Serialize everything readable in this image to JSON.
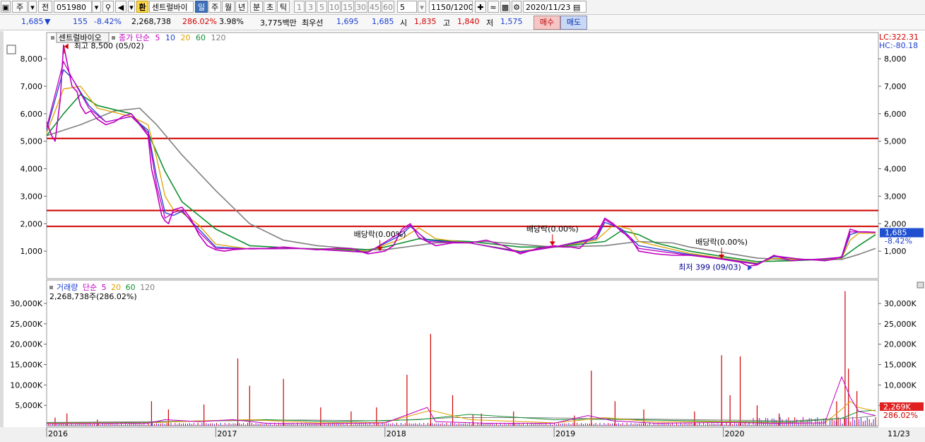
{
  "toolbar": {
    "period_select": "주",
    "market_select": "전",
    "code": "051980",
    "hwan_label": "환",
    "stock_name": "센트럴바이",
    "tabs": [
      "일",
      "주",
      "월",
      "년",
      "분",
      "초",
      "틱"
    ],
    "active_tab": "일",
    "intervals": [
      "1",
      "3",
      "5",
      "10",
      "15",
      "30",
      "45",
      "60"
    ],
    "interval_input": "5",
    "count": "1150",
    "count_total": "/1200",
    "date": "2020/11/23"
  },
  "info": {
    "price": "1,685",
    "change_arrow": "▼",
    "change": "155",
    "change_pct": "-8.42%",
    "volume": "2,268,738",
    "volume_pct": "286.02%",
    "turnover": "3.98%",
    "amount": "3,775백만",
    "bid_label": "최우선",
    "bid1": "1,695",
    "bid2": "1,685",
    "open_label": "시",
    "open": "1,835",
    "high_label": "고",
    "high": "1,840",
    "low_label": "저",
    "low": "1,575",
    "buy_label": "매수",
    "sell_label": "매도"
  },
  "colors": {
    "ma5": "#c000c0",
    "ma10": "#2040d0",
    "ma20": "#e0a000",
    "ma60": "#109030",
    "ma120": "#808080",
    "hline": "#d00000",
    "price_badge": "#2050d0",
    "volume_badge": "#e02020"
  },
  "chart_data": [
    {
      "type": "line",
      "legend": {
        "name": "센트럴바이오",
        "series_label": "종가",
        "ma_type": "단순",
        "periods": [
          "5",
          "10",
          "20",
          "60",
          "120"
        ]
      },
      "ylim": [
        0,
        8800
      ],
      "yticks": [
        "1,000",
        "2,000",
        "3,000",
        "4,000",
        "5,000",
        "6,000",
        "7,000",
        "8,000"
      ],
      "ytick_values": [
        1000,
        2000,
        3000,
        4000,
        5000,
        6000,
        7000,
        8000
      ],
      "x_labels": [
        "2016",
        "2017",
        "2018",
        "2019",
        "2020",
        "11/23"
      ],
      "x_label_dates": [
        2016.0,
        2017.0,
        2018.0,
        2019.0,
        2020.0,
        2020.9
      ],
      "x_range": [
        2016.0,
        2020.9
      ],
      "top_right": {
        "lc": "LC:322.31",
        "hc": "HC:-80.18"
      },
      "current_price": "1,685",
      "current_change": "-8.42%",
      "horizontal_lines": [
        5100,
        2480,
        1900
      ],
      "series": [
        {
          "name": "종가",
          "color": "#c000c0",
          "x": [
            2016.0,
            2016.03,
            2016.05,
            2016.08,
            2016.1,
            2016.13,
            2016.15,
            2016.18,
            2016.2,
            2016.23,
            2016.26,
            2016.3,
            2016.35,
            2016.4,
            2016.45,
            2016.5,
            2016.55,
            2016.6,
            2016.62,
            2016.65,
            2016.68,
            2016.7,
            2016.72,
            2016.75,
            2016.8,
            2016.85,
            2016.9,
            2016.95,
            2017.0,
            2017.05,
            2017.1,
            2017.2,
            2017.3,
            2017.4,
            2017.5,
            2017.6,
            2017.7,
            2017.8,
            2017.9,
            2017.95,
            2018.0,
            2018.05,
            2018.1,
            2018.15,
            2018.2,
            2018.25,
            2018.3,
            2018.4,
            2018.5,
            2018.6,
            2018.7,
            2018.8,
            2018.9,
            2019.0,
            2019.05,
            2019.1,
            2019.15,
            2019.2,
            2019.25,
            2019.3,
            2019.35,
            2019.4,
            2019.45,
            2019.5,
            2019.6,
            2019.7,
            2019.8,
            2019.9,
            2020.0,
            2020.1,
            2020.15,
            2020.2,
            2020.3,
            2020.4,
            2020.5,
            2020.6,
            2020.65,
            2020.7,
            2020.75,
            2020.8,
            2020.85,
            2020.9
          ],
          "y": [
            5700,
            5200,
            5000,
            6500,
            8500,
            7600,
            7000,
            6800,
            6300,
            6000,
            6100,
            5800,
            5600,
            5700,
            5900,
            6000,
            5600,
            5200,
            4000,
            3200,
            2300,
            2100,
            2000,
            2500,
            2600,
            2200,
            1600,
            1200,
            1050,
            1000,
            1050,
            1100,
            1100,
            1150,
            1100,
            1050,
            1100,
            1100,
            900,
            950,
            1000,
            1200,
            1800,
            2000,
            1500,
            1350,
            1200,
            1300,
            1300,
            1400,
            1200,
            900,
            1100,
            1200,
            1150,
            1150,
            1100,
            1400,
            1600,
            2200,
            2000,
            1700,
            1500,
            1000,
            900,
            850,
            850,
            800,
            700,
            600,
            450,
            500,
            850,
            650,
            700,
            650,
            700,
            800,
            1800,
            1700,
            1700,
            1685
          ]
        },
        {
          "name": "5",
          "color": "#c000c0",
          "x": [
            2016.0,
            2016.1,
            2016.15,
            2016.25,
            2016.35,
            2016.5,
            2016.6,
            2016.65,
            2016.7,
            2016.75,
            2016.8,
            2016.9,
            2017.0,
            2017.2,
            2017.5,
            2017.9,
            2018.1,
            2018.15,
            2018.25,
            2018.5,
            2018.8,
            2019.0,
            2019.25,
            2019.3,
            2019.4,
            2019.5,
            2019.8,
            2020.0,
            2020.2,
            2020.3,
            2020.5,
            2020.7,
            2020.75,
            2020.8,
            2020.9
          ],
          "y": [
            5500,
            7900,
            7300,
            6200,
            5700,
            5900,
            5300,
            3400,
            2200,
            2400,
            2500,
            1700,
            1100,
            1080,
            1100,
            950,
            1700,
            1950,
            1350,
            1300,
            950,
            1150,
            1500,
            2150,
            1750,
            1100,
            850,
            700,
            520,
            830,
            680,
            780,
            1700,
            1700,
            1690
          ]
        },
        {
          "name": "10",
          "color": "#2040d0",
          "x": [
            2016.0,
            2016.1,
            2016.15,
            2016.25,
            2016.35,
            2016.5,
            2016.6,
            2016.65,
            2016.7,
            2016.75,
            2016.8,
            2016.9,
            2017.0,
            2017.2,
            2017.5,
            2017.9,
            2018.1,
            2018.15,
            2018.25,
            2018.5,
            2018.8,
            2019.0,
            2019.25,
            2019.3,
            2019.4,
            2019.5,
            2019.8,
            2020.0,
            2020.2,
            2020.3,
            2020.5,
            2020.7,
            2020.75,
            2020.8,
            2020.9
          ],
          "y": [
            5400,
            7600,
            7300,
            6300,
            5700,
            5900,
            5400,
            3700,
            2400,
            2300,
            2450,
            1800,
            1150,
            1080,
            1100,
            970,
            1600,
            1900,
            1400,
            1300,
            980,
            1150,
            1450,
            2050,
            1800,
            1200,
            880,
            720,
            540,
            800,
            690,
            760,
            1600,
            1700,
            1680
          ]
        },
        {
          "name": "20",
          "color": "#e0a000",
          "x": [
            2016.0,
            2016.1,
            2016.2,
            2016.3,
            2016.5,
            2016.6,
            2016.65,
            2016.7,
            2016.75,
            2016.8,
            2016.9,
            2017.0,
            2017.2,
            2017.5,
            2017.9,
            2018.1,
            2018.2,
            2018.3,
            2018.5,
            2018.8,
            2019.0,
            2019.25,
            2019.35,
            2019.45,
            2019.5,
            2019.8,
            2020.0,
            2020.2,
            2020.3,
            2020.5,
            2020.7,
            2020.75,
            2020.8,
            2020.9
          ],
          "y": [
            5300,
            6900,
            7000,
            6200,
            5900,
            5600,
            4400,
            3000,
            2500,
            2400,
            1950,
            1250,
            1080,
            1100,
            1000,
            1450,
            1850,
            1450,
            1300,
            1000,
            1150,
            1400,
            1950,
            1800,
            1350,
            920,
            740,
            560,
            740,
            690,
            740,
            1400,
            1650,
            1650
          ]
        },
        {
          "name": "60",
          "color": "#109030",
          "x": [
            2016.0,
            2016.1,
            2016.2,
            2016.3,
            2016.5,
            2016.6,
            2016.7,
            2016.8,
            2016.9,
            2017.0,
            2017.2,
            2017.5,
            2017.9,
            2018.0,
            2018.2,
            2018.3,
            2018.5,
            2018.8,
            2019.0,
            2019.3,
            2019.4,
            2019.5,
            2019.6,
            2019.8,
            2020.0,
            2020.2,
            2020.4,
            2020.6,
            2020.7,
            2020.8,
            2020.9
          ],
          "y": [
            5200,
            6000,
            6700,
            6300,
            6000,
            5300,
            3900,
            2800,
            2300,
            1800,
            1200,
            1100,
            1050,
            1150,
            1450,
            1400,
            1350,
            1150,
            1150,
            1350,
            1750,
            1600,
            1300,
            1000,
            800,
            620,
            650,
            700,
            750,
            1200,
            1600
          ]
        },
        {
          "name": "120",
          "color": "#808080",
          "x": [
            2016.0,
            2016.2,
            2016.4,
            2016.55,
            2016.65,
            2016.8,
            2017.0,
            2017.2,
            2017.4,
            2017.6,
            2017.9,
            2018.0,
            2018.3,
            2018.6,
            2018.9,
            2019.0,
            2019.3,
            2019.5,
            2019.7,
            2019.8,
            2020.0,
            2020.2,
            2020.4,
            2020.6,
            2020.7,
            2020.8,
            2020.9
          ],
          "y": [
            5200,
            5600,
            6100,
            6200,
            5600,
            4500,
            3200,
            2000,
            1400,
            1200,
            1050,
            1050,
            1300,
            1350,
            1200,
            1150,
            1200,
            1350,
            1300,
            1150,
            950,
            750,
            680,
            690,
            700,
            880,
            1100
          ]
        }
      ],
      "annotations": [
        {
          "text": "최고 8,500 (05/02)",
          "kind": "high",
          "x": 2016.12,
          "y": 8500
        },
        {
          "text": "배당락(0.00%)",
          "kind": "dividend",
          "x": 2017.97,
          "y": 1000
        },
        {
          "text": "배당락(0.00%)",
          "kind": "dividend",
          "x": 2018.99,
          "y": 1200
        },
        {
          "text": "배당락(0.00%)",
          "kind": "dividend",
          "x": 2019.99,
          "y": 720
        },
        {
          "text": "최저 399 (09/03)",
          "kind": "low",
          "x": 2020.17,
          "y": 399
        }
      ]
    },
    {
      "type": "bar",
      "legend": {
        "name": "거래량",
        "ma_type": "단순",
        "periods": [
          "5",
          "20",
          "60",
          "120"
        ],
        "summary": "2,268,738주(286.02%)"
      },
      "ylim": [
        0,
        34000
      ],
      "yticks": [
        "5,000K",
        "10,000K",
        "15,000K",
        "20,000K",
        "25,000K",
        "30,000K"
      ],
      "ytick_values": [
        5000,
        10000,
        15000,
        20000,
        25000,
        30000
      ],
      "current_volume": "2,269K",
      "current_pct": "286.02%",
      "spikes": {
        "x": [
          2016.05,
          2016.12,
          2016.3,
          2016.62,
          2016.72,
          2016.93,
          2017.13,
          2017.2,
          2017.4,
          2017.62,
          2017.8,
          2017.95,
          2018.13,
          2018.27,
          2018.4,
          2018.52,
          2018.57,
          2018.76,
          2019.12,
          2019.22,
          2019.36,
          2019.53,
          2019.83,
          2019.99,
          2020.04,
          2020.1,
          2020.2,
          2020.33,
          2020.67,
          2020.72,
          2020.74,
          2020.79
        ],
        "y": [
          2000,
          3000,
          1500,
          6000,
          4000,
          5200,
          16500,
          9800,
          11500,
          4500,
          3500,
          4500,
          12500,
          22500,
          7500,
          2800,
          3000,
          3500,
          2500,
          13500,
          6000,
          4000,
          3500,
          17300,
          7500,
          17000,
          5000,
          3000,
          6000,
          33000,
          14000,
          8500
        ]
      },
      "ma5": {
        "x": [
          2016.0,
          2016.6,
          2016.7,
          2016.9,
          2017.1,
          2017.3,
          2017.6,
          2018.0,
          2018.25,
          2018.3,
          2018.6,
          2019.0,
          2019.2,
          2019.35,
          2019.6,
          2020.0,
          2020.3,
          2020.6,
          2020.7,
          2020.75,
          2020.8,
          2020.9
        ],
        "y": [
          500,
          600,
          1500,
          1000,
          1500,
          600,
          500,
          700,
          4500,
          1000,
          600,
          600,
          2500,
          1200,
          600,
          800,
          600,
          700,
          12000,
          7000,
          3500,
          2500
        ]
      },
      "ma20": {
        "x": [
          2016.0,
          2016.6,
          2016.9,
          2017.2,
          2017.6,
          2018.0,
          2018.27,
          2018.5,
          2019.0,
          2019.3,
          2019.6,
          2020.0,
          2020.3,
          2020.6,
          2020.7,
          2020.75,
          2020.8,
          2020.9
        ],
        "y": [
          600,
          700,
          1200,
          1500,
          700,
          800,
          3800,
          1500,
          700,
          2000,
          900,
          1000,
          700,
          700,
          4000,
          6000,
          4500,
          3600
        ]
      },
      "ma60": {
        "x": [
          2016.0,
          2016.6,
          2016.9,
          2017.3,
          2017.7,
          2018.2,
          2018.5,
          2019.0,
          2019.3,
          2019.7,
          2020.0,
          2020.4,
          2020.7,
          2020.8,
          2020.9
        ],
        "y": [
          700,
          800,
          1200,
          1500,
          1000,
          1500,
          2800,
          1500,
          1600,
          1300,
          1100,
          900,
          1800,
          3500,
          3800
        ]
      },
      "ma120": {
        "x": [
          2016.0,
          2016.6,
          2017.0,
          2017.5,
          2018.0,
          2018.4,
          2018.8,
          2019.2,
          2019.6,
          2020.0,
          2020.4,
          2020.8,
          2020.9
        ],
        "y": [
          800,
          1000,
          1200,
          1400,
          1200,
          2000,
          2000,
          1800,
          1600,
          1400,
          1200,
          2000,
          2500
        ]
      }
    }
  ]
}
